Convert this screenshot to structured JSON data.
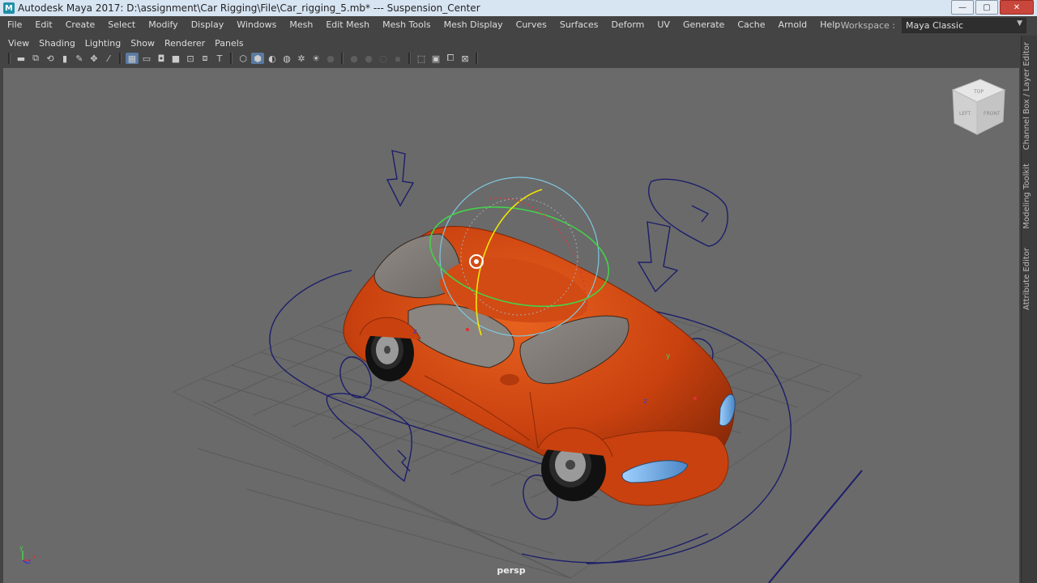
{
  "window": {
    "title": "Autodesk Maya 2017: D:\\assignment\\Car Rigging\\File\\Car_rigging_5.mb*   ---   Suspension_Center",
    "logo": "M",
    "buttons": [
      "—",
      "▢",
      "✕"
    ]
  },
  "menubar": {
    "items": [
      "File",
      "Edit",
      "Create",
      "Select",
      "Modify",
      "Display",
      "Windows",
      "Mesh",
      "Edit Mesh",
      "Mesh Tools",
      "Mesh Display",
      "Curves",
      "Surfaces",
      "Deform",
      "UV",
      "Generate",
      "Cache",
      "Arnold",
      "Help"
    ],
    "workspace_label": "Workspace :",
    "workspace_value": "Maya Classic"
  },
  "panel_menu": {
    "items": [
      "View",
      "Shading",
      "Lighting",
      "Show",
      "Renderer",
      "Panels"
    ]
  },
  "viewport": {
    "camera_label": "persp",
    "viewcube_faces": [
      "TOP",
      "LEFT",
      "FRONT"
    ],
    "axis_labels": [
      "y",
      "z",
      "x"
    ],
    "locator_labels": [
      "z",
      "y",
      "z"
    ]
  },
  "side_tabs": [
    "Channel Box / Layer Editor",
    "Modeling Toolkit",
    "Attribute Editor"
  ],
  "colors": {
    "car_body": "#c9410f",
    "grid": "#5a5a5a",
    "control_curve": "#1c1e6a",
    "viewport_bg": "#6a6a6a"
  }
}
